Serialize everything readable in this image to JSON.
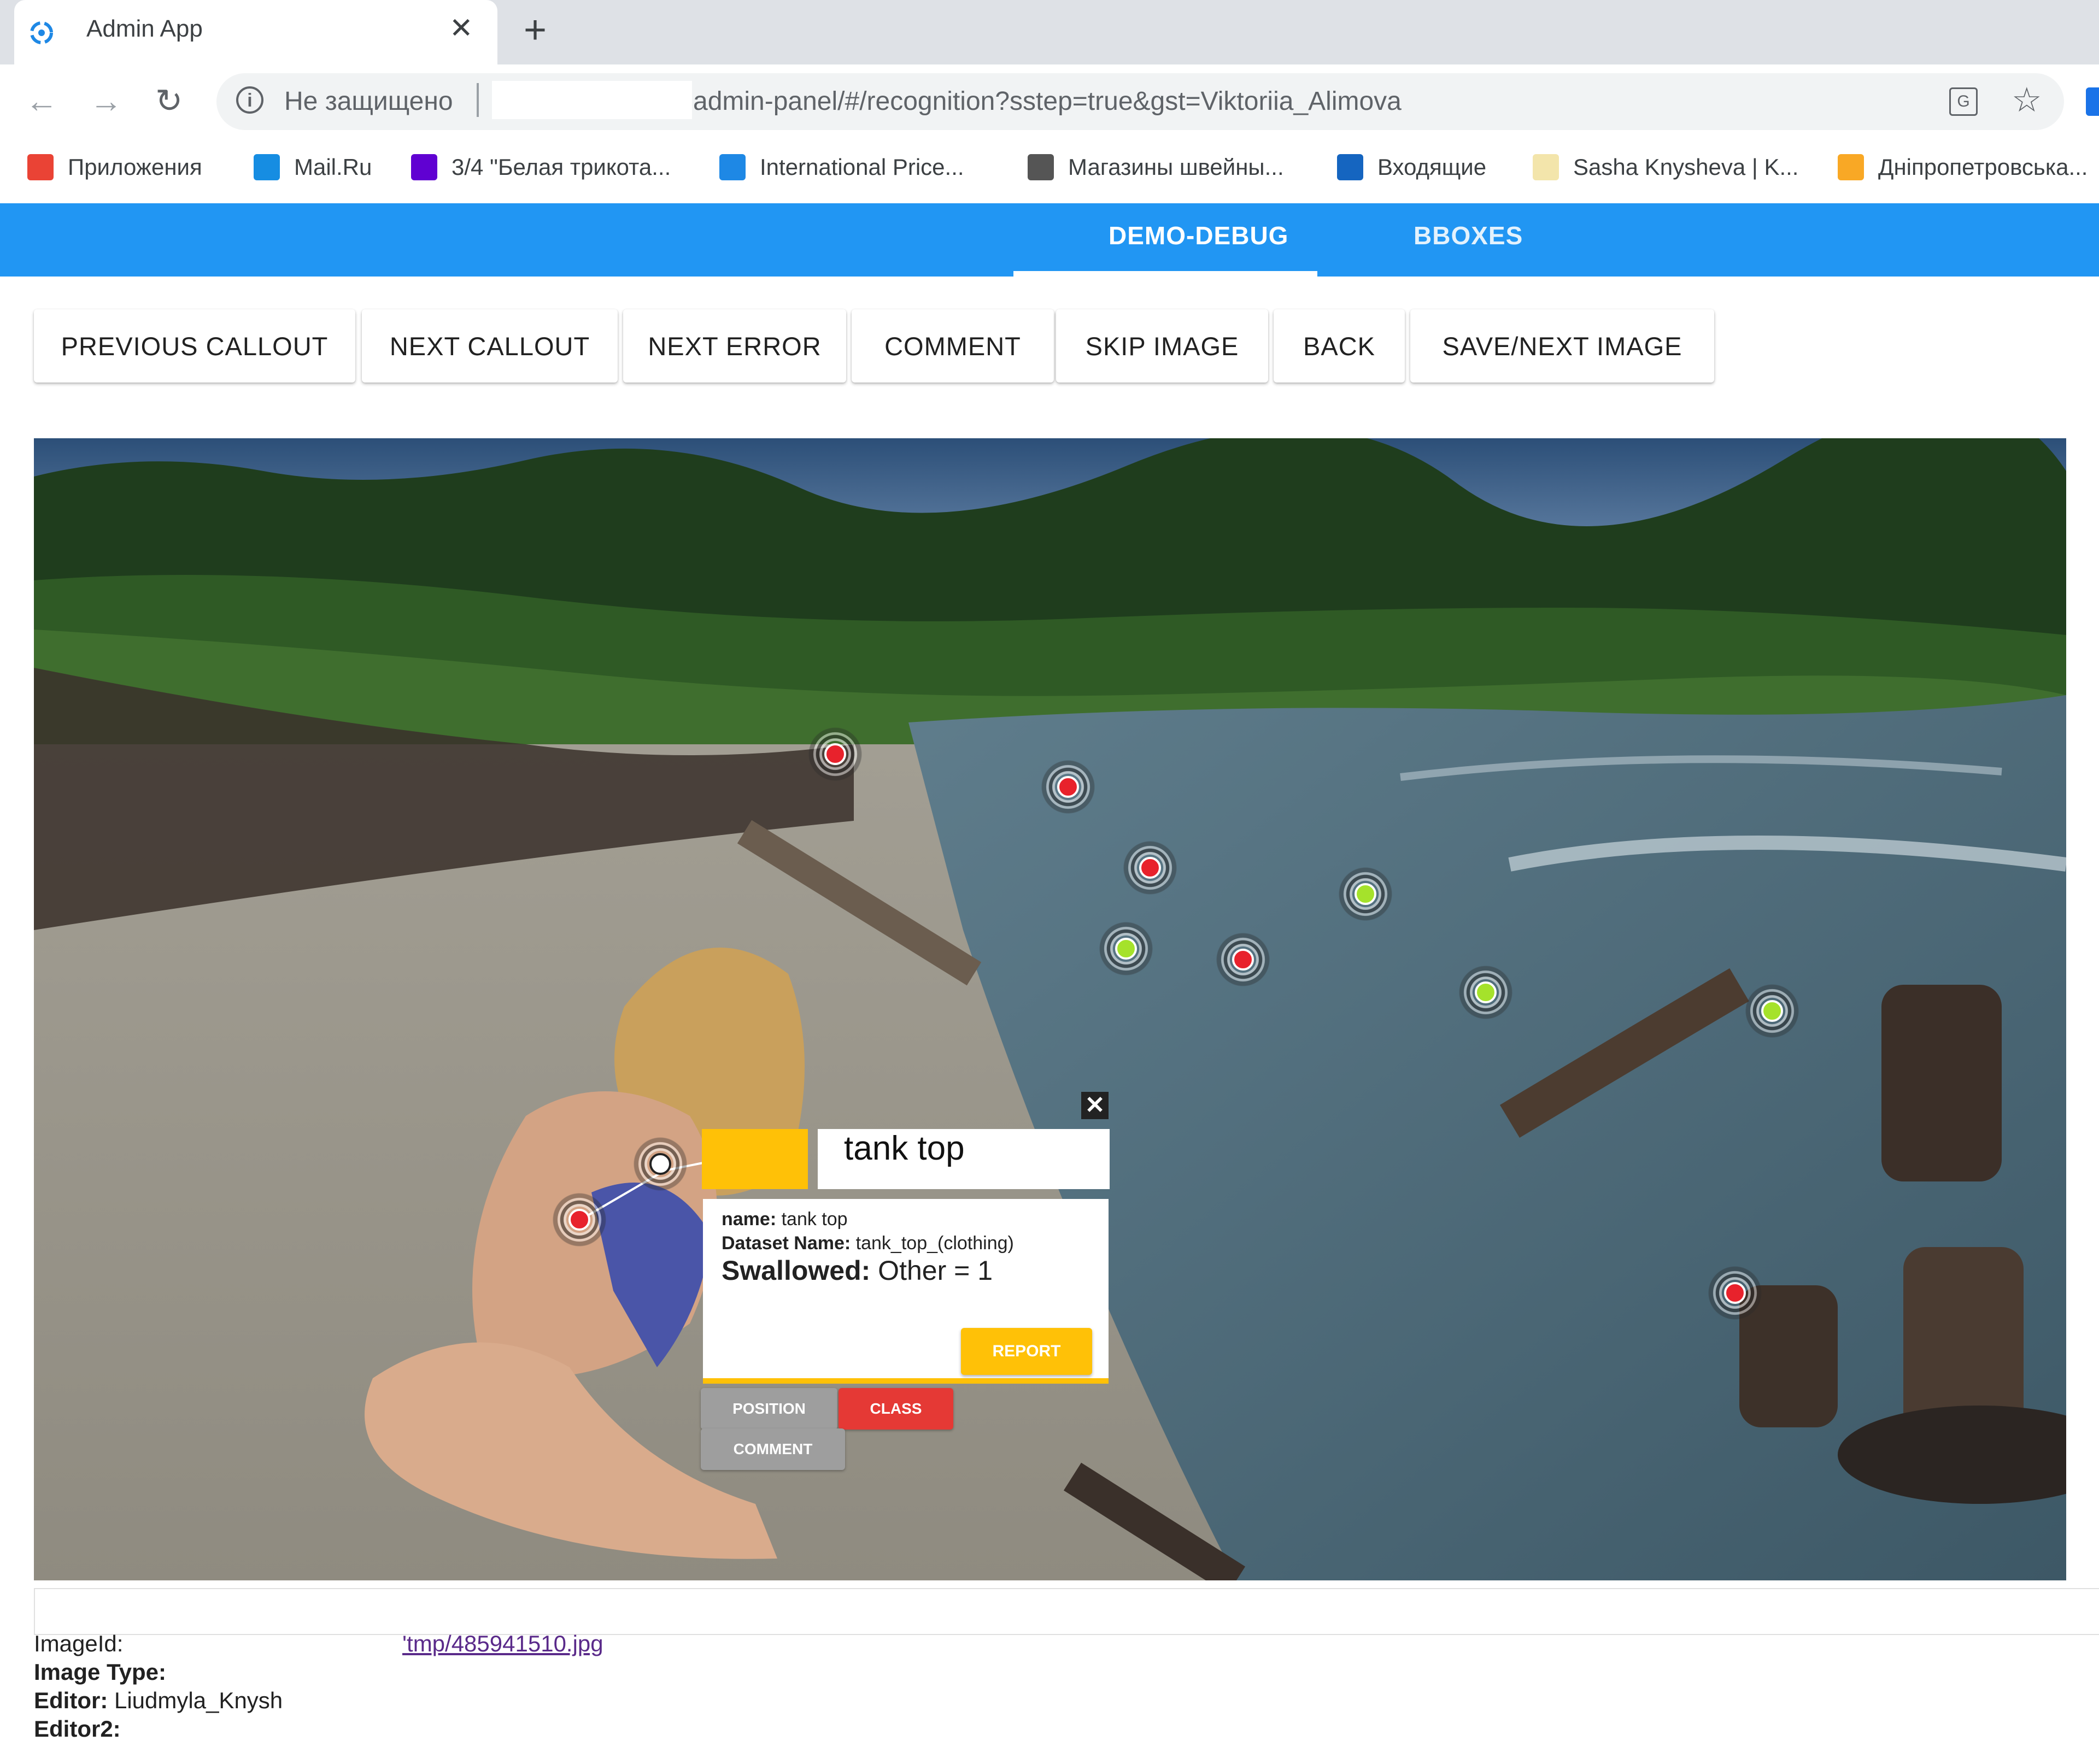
{
  "browser": {
    "tab_title": "Admin App",
    "tab_close": "✕",
    "new_tab": "+",
    "not_secure": "Не защищено",
    "url": "admin-panel/#/recognition?sstep=true&gst=Viktoriia_Alimova",
    "bookmarks": [
      {
        "label": "Приложения",
        "icon": "apps-grid-icon",
        "color": "#ea4335"
      },
      {
        "label": "Mail.Ru",
        "icon": "mailru-icon",
        "color": "#168de2"
      },
      {
        "label": "3/4 \"Белая трикота...",
        "icon": "yahoo-icon",
        "color": "#6001d2"
      },
      {
        "label": "International Price...",
        "icon": "document-icon",
        "color": "#1e88e5"
      },
      {
        "label": "Магазины швейны...",
        "icon": "sewing-icon",
        "color": "#555555"
      },
      {
        "label": "Входящие",
        "icon": "pen-icon",
        "color": "#1565c0"
      },
      {
        "label": "Sasha Knysheva | K...",
        "icon": "sun-icon",
        "color": "#f3e5ab"
      },
      {
        "label": "Дніпропетровська...",
        "icon": "counter-icon",
        "color": "#f9a825"
      }
    ]
  },
  "app": {
    "tabs": [
      {
        "label": "DEMO-DEBUG",
        "active": true
      },
      {
        "label": "BBOXES",
        "active": false
      }
    ],
    "actions": [
      "PREVIOUS CALLOUT",
      "NEXT CALLOUT",
      "NEXT ERROR",
      "COMMENT",
      "SKIP IMAGE",
      "BACK",
      "SAVE/NEXT IMAGE"
    ]
  },
  "markers": [
    {
      "status": "red"
    },
    {
      "status": "red"
    },
    {
      "status": "red"
    },
    {
      "status": "green"
    },
    {
      "status": "green"
    },
    {
      "status": "red"
    },
    {
      "status": "green"
    },
    {
      "status": "green"
    },
    {
      "status": "red"
    },
    {
      "status": "red"
    },
    {
      "status": "selected"
    }
  ],
  "callout": {
    "swatch_color": "#ffc107",
    "title": "tank top",
    "close": "✕",
    "name_label": "name:",
    "name_value": "tank top",
    "dataset_label": "Dataset Name:",
    "dataset_value": "tank_top_(clothing)",
    "swallowed_label": "Swallowed:",
    "swallowed_value": "Other = 1",
    "report": "REPORT",
    "position": "POSITION",
    "class": "CLASS",
    "comment": "COMMENT"
  },
  "info": {
    "image_id_label": "ImageId:",
    "image_id_value": "'tmp/485941510.jpg",
    "image_type_label": "Image Type:",
    "editor_label": "Editor:",
    "editor_value": "Liudmyla_Knysh",
    "editor2_label": "Editor2:"
  }
}
